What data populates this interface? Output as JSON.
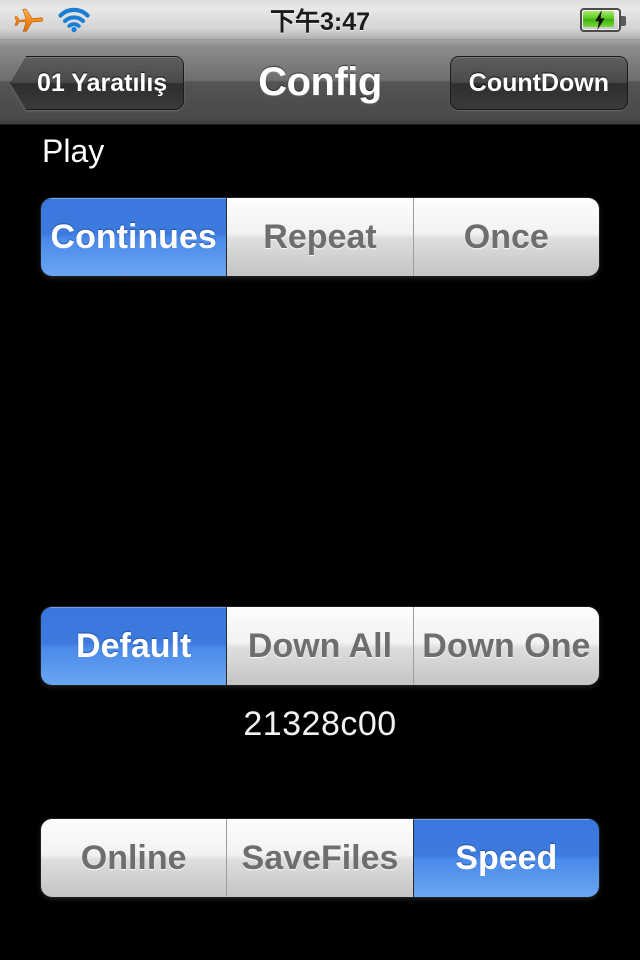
{
  "statusbar": {
    "airplane_icon": "airplane-icon",
    "wifi_icon": "wifi-icon",
    "time": "下午3:47",
    "battery_icon": "battery-charging-icon"
  },
  "navbar": {
    "back_label": "01 Yaratılış",
    "title": "Config",
    "right_label": "CountDown"
  },
  "content": {
    "play_label": "Play",
    "hex_value": "21328c00"
  },
  "segments": {
    "play_mode": {
      "items": [
        {
          "label": "Continues",
          "selected": true
        },
        {
          "label": "Repeat",
          "selected": false
        },
        {
          "label": "Once",
          "selected": false
        }
      ]
    },
    "download_mode": {
      "items": [
        {
          "label": "Default",
          "selected": true
        },
        {
          "label": "Down All",
          "selected": false
        },
        {
          "label": "Down One",
          "selected": false
        }
      ]
    },
    "source_mode": {
      "items": [
        {
          "label": "Online",
          "selected": false
        },
        {
          "label": "SaveFiles",
          "selected": false
        },
        {
          "label": "Speed",
          "selected": true
        }
      ]
    }
  },
  "colors": {
    "background": "#000000",
    "accent_blue": "#3c7ade",
    "segment_gray": "#dedede",
    "navbar_dark": "#4a4a4a",
    "battery_green": "#55c81d",
    "airplane_orange": "#f08a22",
    "wifi_blue": "#1a7fd4"
  }
}
